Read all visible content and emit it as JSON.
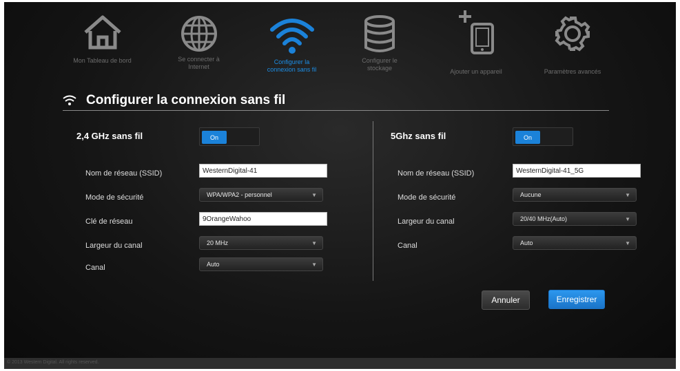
{
  "nav": {
    "items": [
      {
        "label": "Mon Tableau de bord",
        "icon": "home-icon"
      },
      {
        "label": "Se connecter à\nInternet",
        "icon": "globe-icon"
      },
      {
        "label": "Configurer la\nconnexion sans fil",
        "icon": "wifi-icon"
      },
      {
        "label": "Configurer le\nstockage",
        "icon": "storage-icon"
      },
      {
        "label": "Ajouter un appareil",
        "icon": "add-device-icon"
      },
      {
        "label": "Paramètres avancés",
        "icon": "gear-icon"
      }
    ],
    "active_index": 2
  },
  "page": {
    "title": "Configurer la connexion sans fil"
  },
  "band24": {
    "title": "2,4 GHz sans fil",
    "toggle_label": "On",
    "fields": {
      "ssid_label": "Nom de réseau (SSID)",
      "ssid_value": "WesternDigital-41",
      "security_label": "Mode de sécurité",
      "security_value": "WPA/WPA2 - personnel",
      "key_label": "Clé de réseau",
      "key_value": "9OrangeWahoo",
      "width_label": "Largeur du canal",
      "width_value": "20 MHz",
      "channel_label": "Canal",
      "channel_value": "Auto"
    }
  },
  "band5": {
    "title": "5Ghz sans fil",
    "toggle_label": "On",
    "fields": {
      "ssid_label": "Nom de réseau (SSID)",
      "ssid_value": "WesternDigital-41_5G",
      "security_label": "Mode de sécurité",
      "security_value": "Aucune",
      "width_label": "Largeur du canal",
      "width_value": "20/40 MHz(Auto)",
      "channel_label": "Canal",
      "channel_value": "Auto"
    }
  },
  "actions": {
    "cancel_label": "Annuler",
    "save_label": "Enregistrer"
  },
  "footer": {
    "text": "© 2013 Western Digital. All rights reserved."
  },
  "colors": {
    "accent": "#1b82d9",
    "background": "#151515",
    "icon_gray": "#8a8a8a"
  }
}
